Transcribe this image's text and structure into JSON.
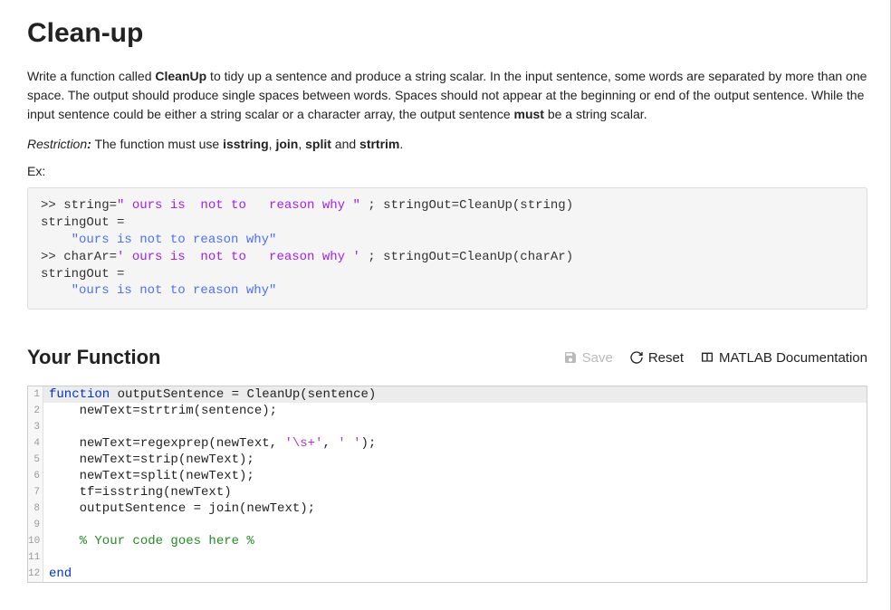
{
  "title": "Clean-up",
  "desc_before_fn": "Write a function called ",
  "fn_name": "CleanUp",
  "desc_after_fn_before_must": " to tidy up a sentence and produce a string scalar. In the input sentence, some words are separated by more than one space. The output should produce single spaces between words. Spaces should not appear at the beginning or end of the output sentence. While the input sentence could be either a string scalar or a character array, the output sentence ",
  "must": "must",
  "desc_tail": " be a string scalar.",
  "restriction_label": "Restriction",
  "restriction_colon": ":",
  "restriction_text": " The function must use ",
  "r1": "isstring",
  "rcomma1": ", ",
  "r2": "join",
  "rcomma2": ", ",
  "r3": "split",
  "rand": " and ",
  "r4": "strtrim",
  "rperiod": ".",
  "ex_label": "Ex:",
  "example": {
    "l1a": ">> string=",
    "l1s": "\" ours is  not to   reason why \"",
    "l1b": " ; stringOut=CleanUp(string)",
    "l2": "stringOut = ",
    "l3q1": "    \"ours is not to reason why\"",
    "l4a": ">> charAr=",
    "l4s": "' ours is  not to   reason why '",
    "l4b": " ; stringOut=CleanUp(charAr)",
    "l5": "stringOut = ",
    "l6q": "    \"ours is not to reason why\""
  },
  "your_function": "Your Function",
  "actions": {
    "save": "Save",
    "reset": "Reset",
    "docs": "MATLAB Documentation"
  },
  "code": {
    "l1": {
      "kw": "function",
      "rest": " outputSentence = CleanUp(sentence)"
    },
    "l2": "    newText=strtrim(sentence);",
    "l3": "",
    "l4a": "    newText=regexprep(newText, ",
    "l4s1": "'\\s+'",
    "l4c": ", ",
    "l4s2": "' '",
    "l4b": ");",
    "l5": "    newText=strip(newText);",
    "l6": "    newText=split(newText);",
    "l7": "    tf=isstring(newText)",
    "l8": "    outputSentence = join(newText);",
    "l9": "",
    "l10": "    % Your code goes here %",
    "l11": "",
    "l12": {
      "kw": "end"
    }
  },
  "linenums": [
    "1",
    "2",
    "3",
    "4",
    "5",
    "6",
    "7",
    "8",
    "9",
    "10",
    "11",
    "12"
  ]
}
